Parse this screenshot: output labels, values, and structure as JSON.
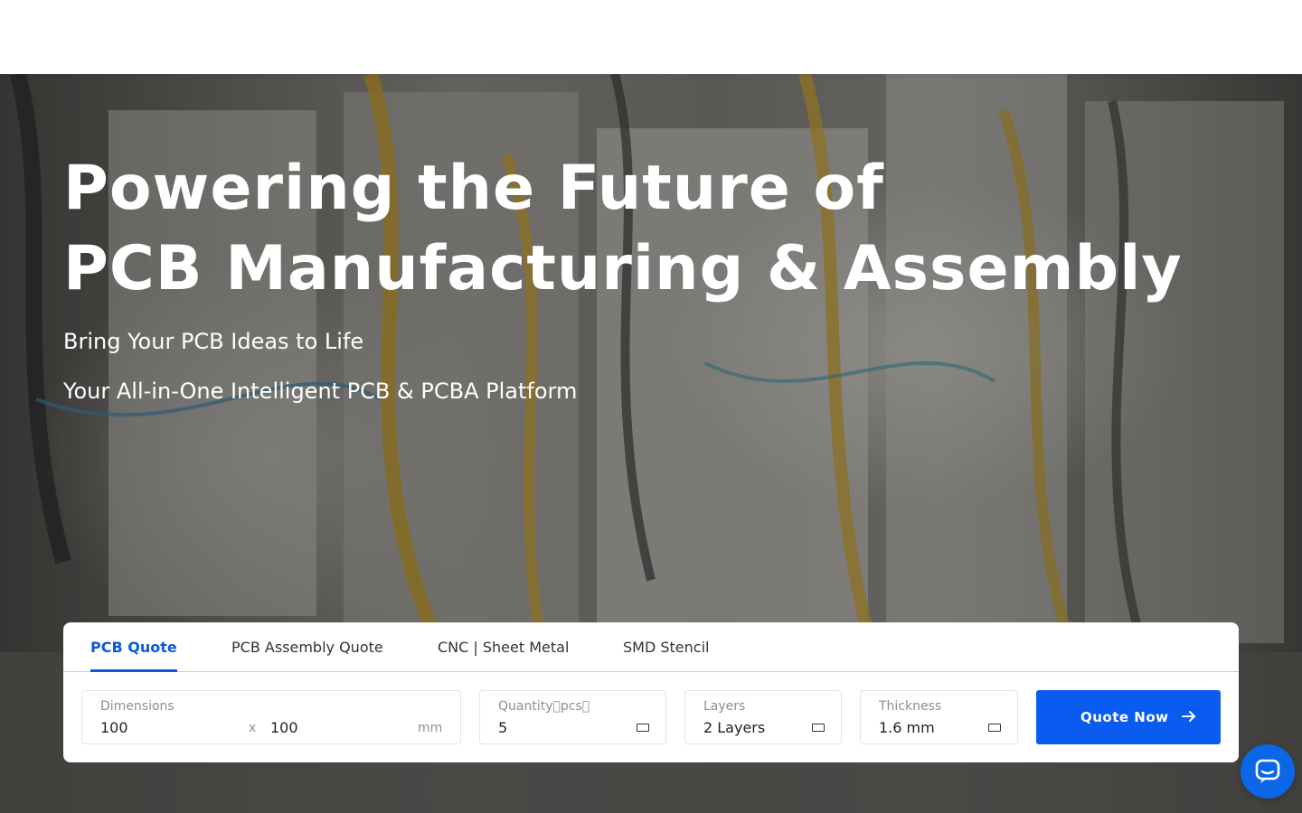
{
  "hero": {
    "headline_line1": "Powering the Future of",
    "headline_line2": "PCB Manufacturing & Assembly",
    "subtitle1": "Bring Your PCB Ideas to Life",
    "subtitle2": "Your All-in-One Intelligent PCB & PCBA Platform"
  },
  "quote": {
    "tabs": [
      {
        "label": "PCB Quote",
        "active": true
      },
      {
        "label": "PCB Assembly Quote",
        "active": false
      },
      {
        "label": "CNC | Sheet Metal",
        "active": false
      },
      {
        "label": "SMD Stencil",
        "active": false
      }
    ],
    "dimensions": {
      "label": "Dimensions",
      "width": "100",
      "separator": "x",
      "height": "100",
      "unit": "mm"
    },
    "quantity": {
      "label": "Quantity\u0000pcs\u0000",
      "value": "5"
    },
    "layers": {
      "label": "Layers",
      "value": "2 Layers"
    },
    "thickness": {
      "label": "Thickness",
      "value": "1.6 mm"
    },
    "button_label": "Quote Now"
  },
  "icons": {
    "arrow": "arrow-right-icon",
    "select": "dropdown-icon",
    "chat": "chat-bubble-icon"
  },
  "colors": {
    "accent": "#0a5bf0",
    "tab_active": "#0a5bd8",
    "chat": "#0b67e8"
  }
}
